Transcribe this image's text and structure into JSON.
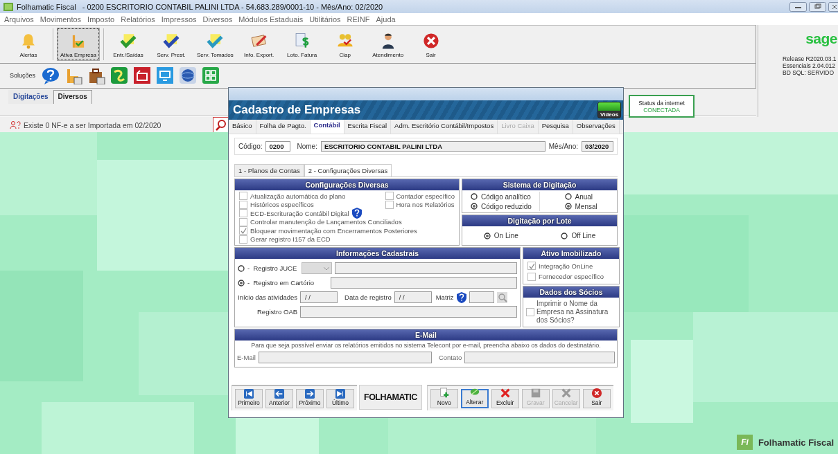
{
  "window": {
    "title": "Folhamatic Fiscal   - 0200 ESCRITORIO CONTABIL PALINI LTDA - 54.683.289/0001-10 - Mês/Ano: 02/2020"
  },
  "menu": [
    "Arquivos",
    "Movimentos",
    "Imposto",
    "Relatórios",
    "Impressos",
    "Diversos",
    "Módulos Estaduais",
    "Utilitários",
    "REINF",
    "Ajuda"
  ],
  "toolbar": [
    {
      "label": "Alertas",
      "selected": false
    },
    {
      "label": "Ativa Empresa",
      "selected": true
    },
    {
      "label": "Entr./Saídas",
      "selected": false
    },
    {
      "label": "Serv. Prest.",
      "selected": false
    },
    {
      "label": "Serv. Tomados",
      "selected": false
    },
    {
      "label": "Info. Export.",
      "selected": false
    },
    {
      "label": "Loto. Fatura",
      "selected": false
    },
    {
      "label": "Ciap",
      "selected": false
    },
    {
      "label": "Atendimento",
      "selected": false
    },
    {
      "label": "Sair",
      "selected": false
    }
  ],
  "solutions": {
    "label": "Soluções"
  },
  "sage": {
    "logo": "sage",
    "lines": [
      "Release R2020.03.1",
      "Essenciais 2.04.012",
      "BD SQL: SERVIDO"
    ]
  },
  "main_tabs": [
    {
      "label": "Digitações",
      "selected": true
    },
    {
      "label": "Diversos",
      "selected": false
    }
  ],
  "internet_status": {
    "label": "Status da internet",
    "value": "CONECTADA"
  },
  "notice": "Existe 0 NF-e a ser Importada em 02/2020",
  "brand": {
    "badge": "Fi",
    "name": "Folhamatic Fiscal"
  },
  "dialog": {
    "title": "Cadastro de Empresas",
    "videos": "Vídeos",
    "tabs": [
      {
        "label": "Básico",
        "selected": false,
        "disabled": false
      },
      {
        "label": "Folha de Pagto.",
        "selected": false,
        "disabled": false
      },
      {
        "label": "Contábil",
        "selected": true,
        "disabled": false
      },
      {
        "label": "Escrita Fiscal",
        "selected": false,
        "disabled": false
      },
      {
        "label": "Adm. Escritório Contábil/Impostos",
        "selected": false,
        "disabled": false
      },
      {
        "label": "Livro Caixa",
        "selected": false,
        "disabled": true
      },
      {
        "label": "Pesquisa",
        "selected": false,
        "disabled": false
      },
      {
        "label": "Observações",
        "selected": false,
        "disabled": false
      }
    ],
    "company": {
      "code_label": "Código:",
      "code": "0200",
      "name_label": "Nome:",
      "name": "ESCRITORIO CONTABIL PALINI LTDA",
      "period_label": "Mês/Ano:",
      "period": "03/2020"
    },
    "subtabs": [
      {
        "label": "1 - Planos de Contas",
        "selected": false
      },
      {
        "label": "2 - Configurações Diversas",
        "selected": true
      }
    ],
    "config": {
      "title": "Configurações Diversas",
      "options": [
        {
          "label": "Atualização automática do plano",
          "checked": false
        },
        {
          "label": "Históricos específicos",
          "checked": false
        },
        {
          "label": "ECD-Escrituração Contábil Digital",
          "checked": false,
          "help": true
        },
        {
          "label": "Controlar manutenção de Lançamentos Conciliados",
          "checked": false
        },
        {
          "label": "Bloquear movimentação com Encerramentos Posteriores",
          "checked": true
        },
        {
          "label": "Gerar registro I157 da ECD",
          "checked": false
        }
      ],
      "side_options": [
        {
          "label": "Contador específico",
          "checked": false
        },
        {
          "label": "Hora nos Relatórios",
          "checked": false
        }
      ]
    },
    "typing": {
      "title": "Sistema de Digitação",
      "code_modes": [
        {
          "label": "Código analítico",
          "selected": false
        },
        {
          "label": "Código reduzido",
          "selected": true
        }
      ],
      "periods": [
        {
          "label": "Anual",
          "selected": false
        },
        {
          "label": "Mensal",
          "selected": true
        }
      ]
    },
    "batch": {
      "title": "Digitação por Lote",
      "modes": [
        {
          "label": "On Line",
          "selected": true
        },
        {
          "label": "Off Line",
          "selected": false
        }
      ]
    },
    "registration": {
      "title": "Informações Cadastrais",
      "registries": [
        {
          "label": "-  Registro JUCE",
          "selected": false
        },
        {
          "label": "-  Registro em Cartório",
          "selected": true
        }
      ],
      "start_label": "Início das atividades",
      "start": "/ /",
      "reg_date_label": "Data de registro",
      "reg_date": "/ /",
      "matrix_label": "Matriz",
      "oab_label": "Registro OAB"
    },
    "assets": {
      "title": "Ativo Imobilizado",
      "options": [
        {
          "label": "Integração OnLine",
          "checked": true
        },
        {
          "label": "Fornecedor específico",
          "checked": false
        }
      ]
    },
    "partners": {
      "title": "Dados dos Sócios",
      "options": [
        {
          "label": "Imprimir o Nome da Empresa na Assinatura dos Sócios?",
          "checked": false
        }
      ]
    },
    "email": {
      "title": "E-Mail",
      "note": "Para que seja possível enviar os relatórios emitidos no sistema Telecont por e-mail, preencha abaixo os dados do destinatário.",
      "email_label": "E-Mail",
      "contact_label": "Contato"
    },
    "nav": [
      "Primeiro",
      "Anterior",
      "Próximo",
      "Último"
    ],
    "logo": "FOLHAMATIC",
    "actions": [
      {
        "label": "Novo",
        "selected": false,
        "disabled": false
      },
      {
        "label": "Alterar",
        "selected": true,
        "disabled": false
      },
      {
        "label": "Excluir",
        "selected": false,
        "disabled": false
      },
      {
        "label": "Gravar",
        "selected": false,
        "disabled": true
      },
      {
        "label": "Cancelar",
        "selected": false,
        "disabled": true
      },
      {
        "label": "Sair",
        "selected": false,
        "disabled": false
      }
    ]
  }
}
